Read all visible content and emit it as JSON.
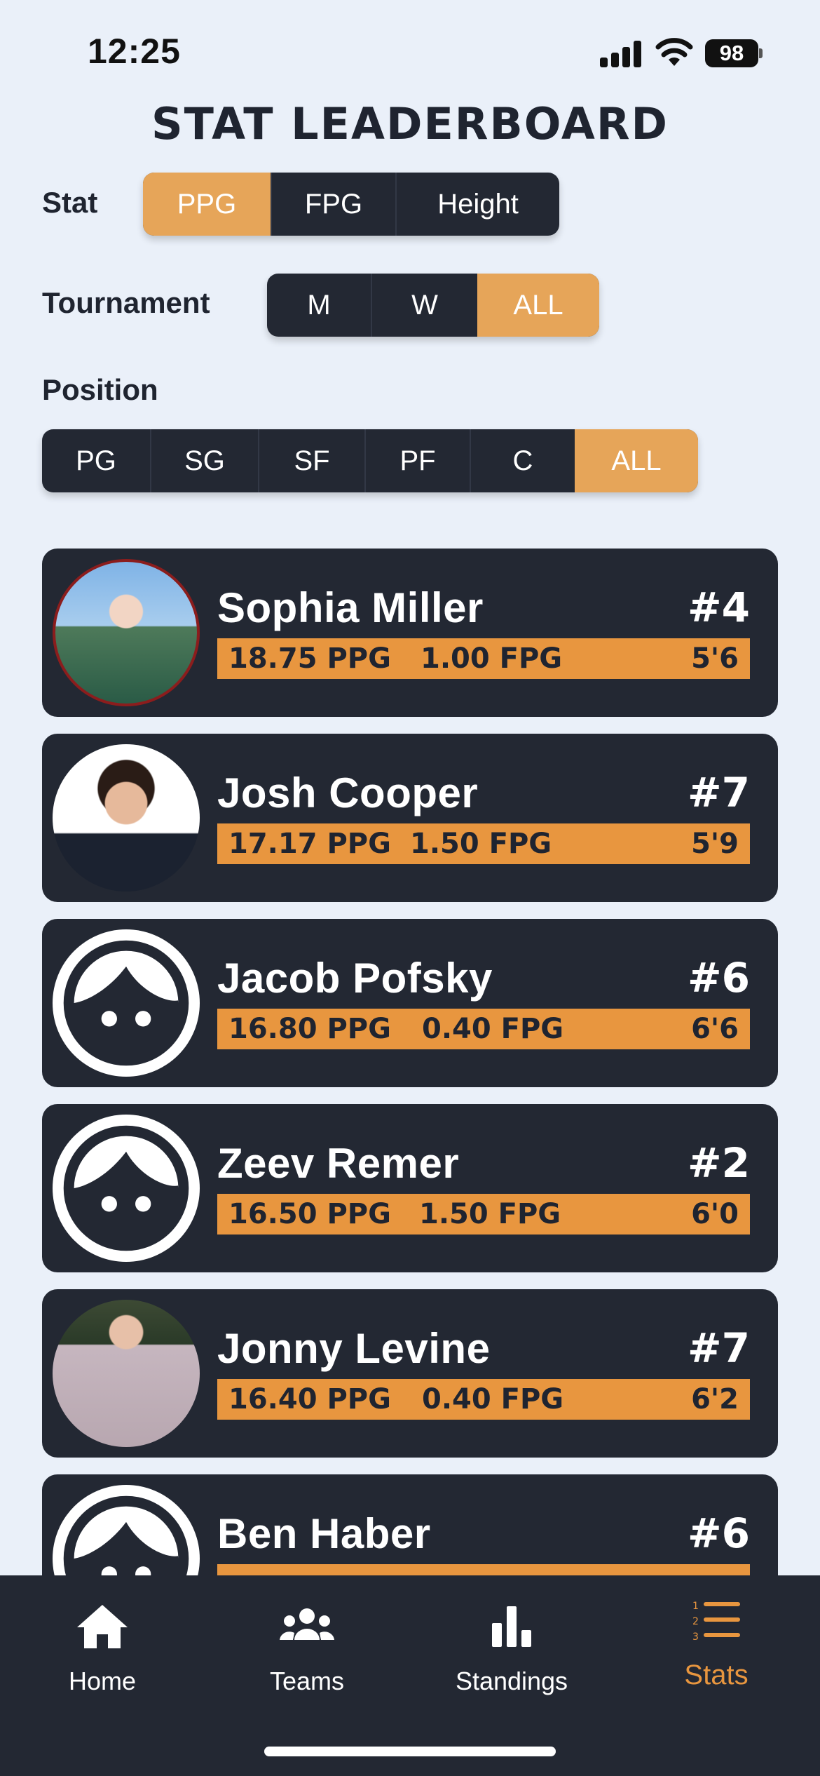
{
  "status_bar": {
    "time": "12:25",
    "battery": "98"
  },
  "title": "STAT LEADERBOARD",
  "stat_filter": {
    "label": "Stat",
    "options": [
      "PPG",
      "FPG",
      "Height"
    ],
    "selected": "PPG"
  },
  "tournament_filter": {
    "label": "Tournament",
    "options": [
      "M",
      "W",
      "ALL"
    ],
    "selected": "ALL"
  },
  "position_filter": {
    "label": "Position",
    "options": [
      "PG",
      "SG",
      "SF",
      "PF",
      "C",
      "ALL"
    ],
    "selected": "ALL"
  },
  "colors": {
    "accent": "#e8963f",
    "accent_light": "#e6a559",
    "card_bg": "#232833",
    "page_bg": "#eaf0f9"
  },
  "players": [
    {
      "name": "Sophia Miller",
      "number": "#4",
      "ppg": "18.75 PPG",
      "fpg": "1.00 FPG",
      "height": "5'6",
      "avatar": "photo"
    },
    {
      "name": "Josh Cooper",
      "number": "#7",
      "ppg": "17.17 PPG",
      "fpg": "1.50 FPG",
      "height": "5'9",
      "avatar": "photo"
    },
    {
      "name": "Jacob Pofsky",
      "number": "#6",
      "ppg": "16.80 PPG",
      "fpg": "0.40 FPG",
      "height": "6'6",
      "avatar": "default-face-icon"
    },
    {
      "name": "Zeev Remer",
      "number": "#2",
      "ppg": "16.50 PPG",
      "fpg": "1.50 FPG",
      "height": "6'0",
      "avatar": "default-face-icon"
    },
    {
      "name": "Jonny Levine",
      "number": "#7",
      "ppg": "16.40 PPG",
      "fpg": "0.40 FPG",
      "height": "6'2",
      "avatar": "photo"
    },
    {
      "name": "Ben Haber",
      "number": "#6",
      "avatar": "default-face-icon"
    }
  ],
  "tabs": [
    {
      "label": "Home",
      "icon": "home-icon",
      "active": false
    },
    {
      "label": "Teams",
      "icon": "people-icon",
      "active": false
    },
    {
      "label": "Standings",
      "icon": "bar-chart-icon",
      "active": false
    },
    {
      "label": "Stats",
      "icon": "ranked-list-icon",
      "active": true
    }
  ]
}
